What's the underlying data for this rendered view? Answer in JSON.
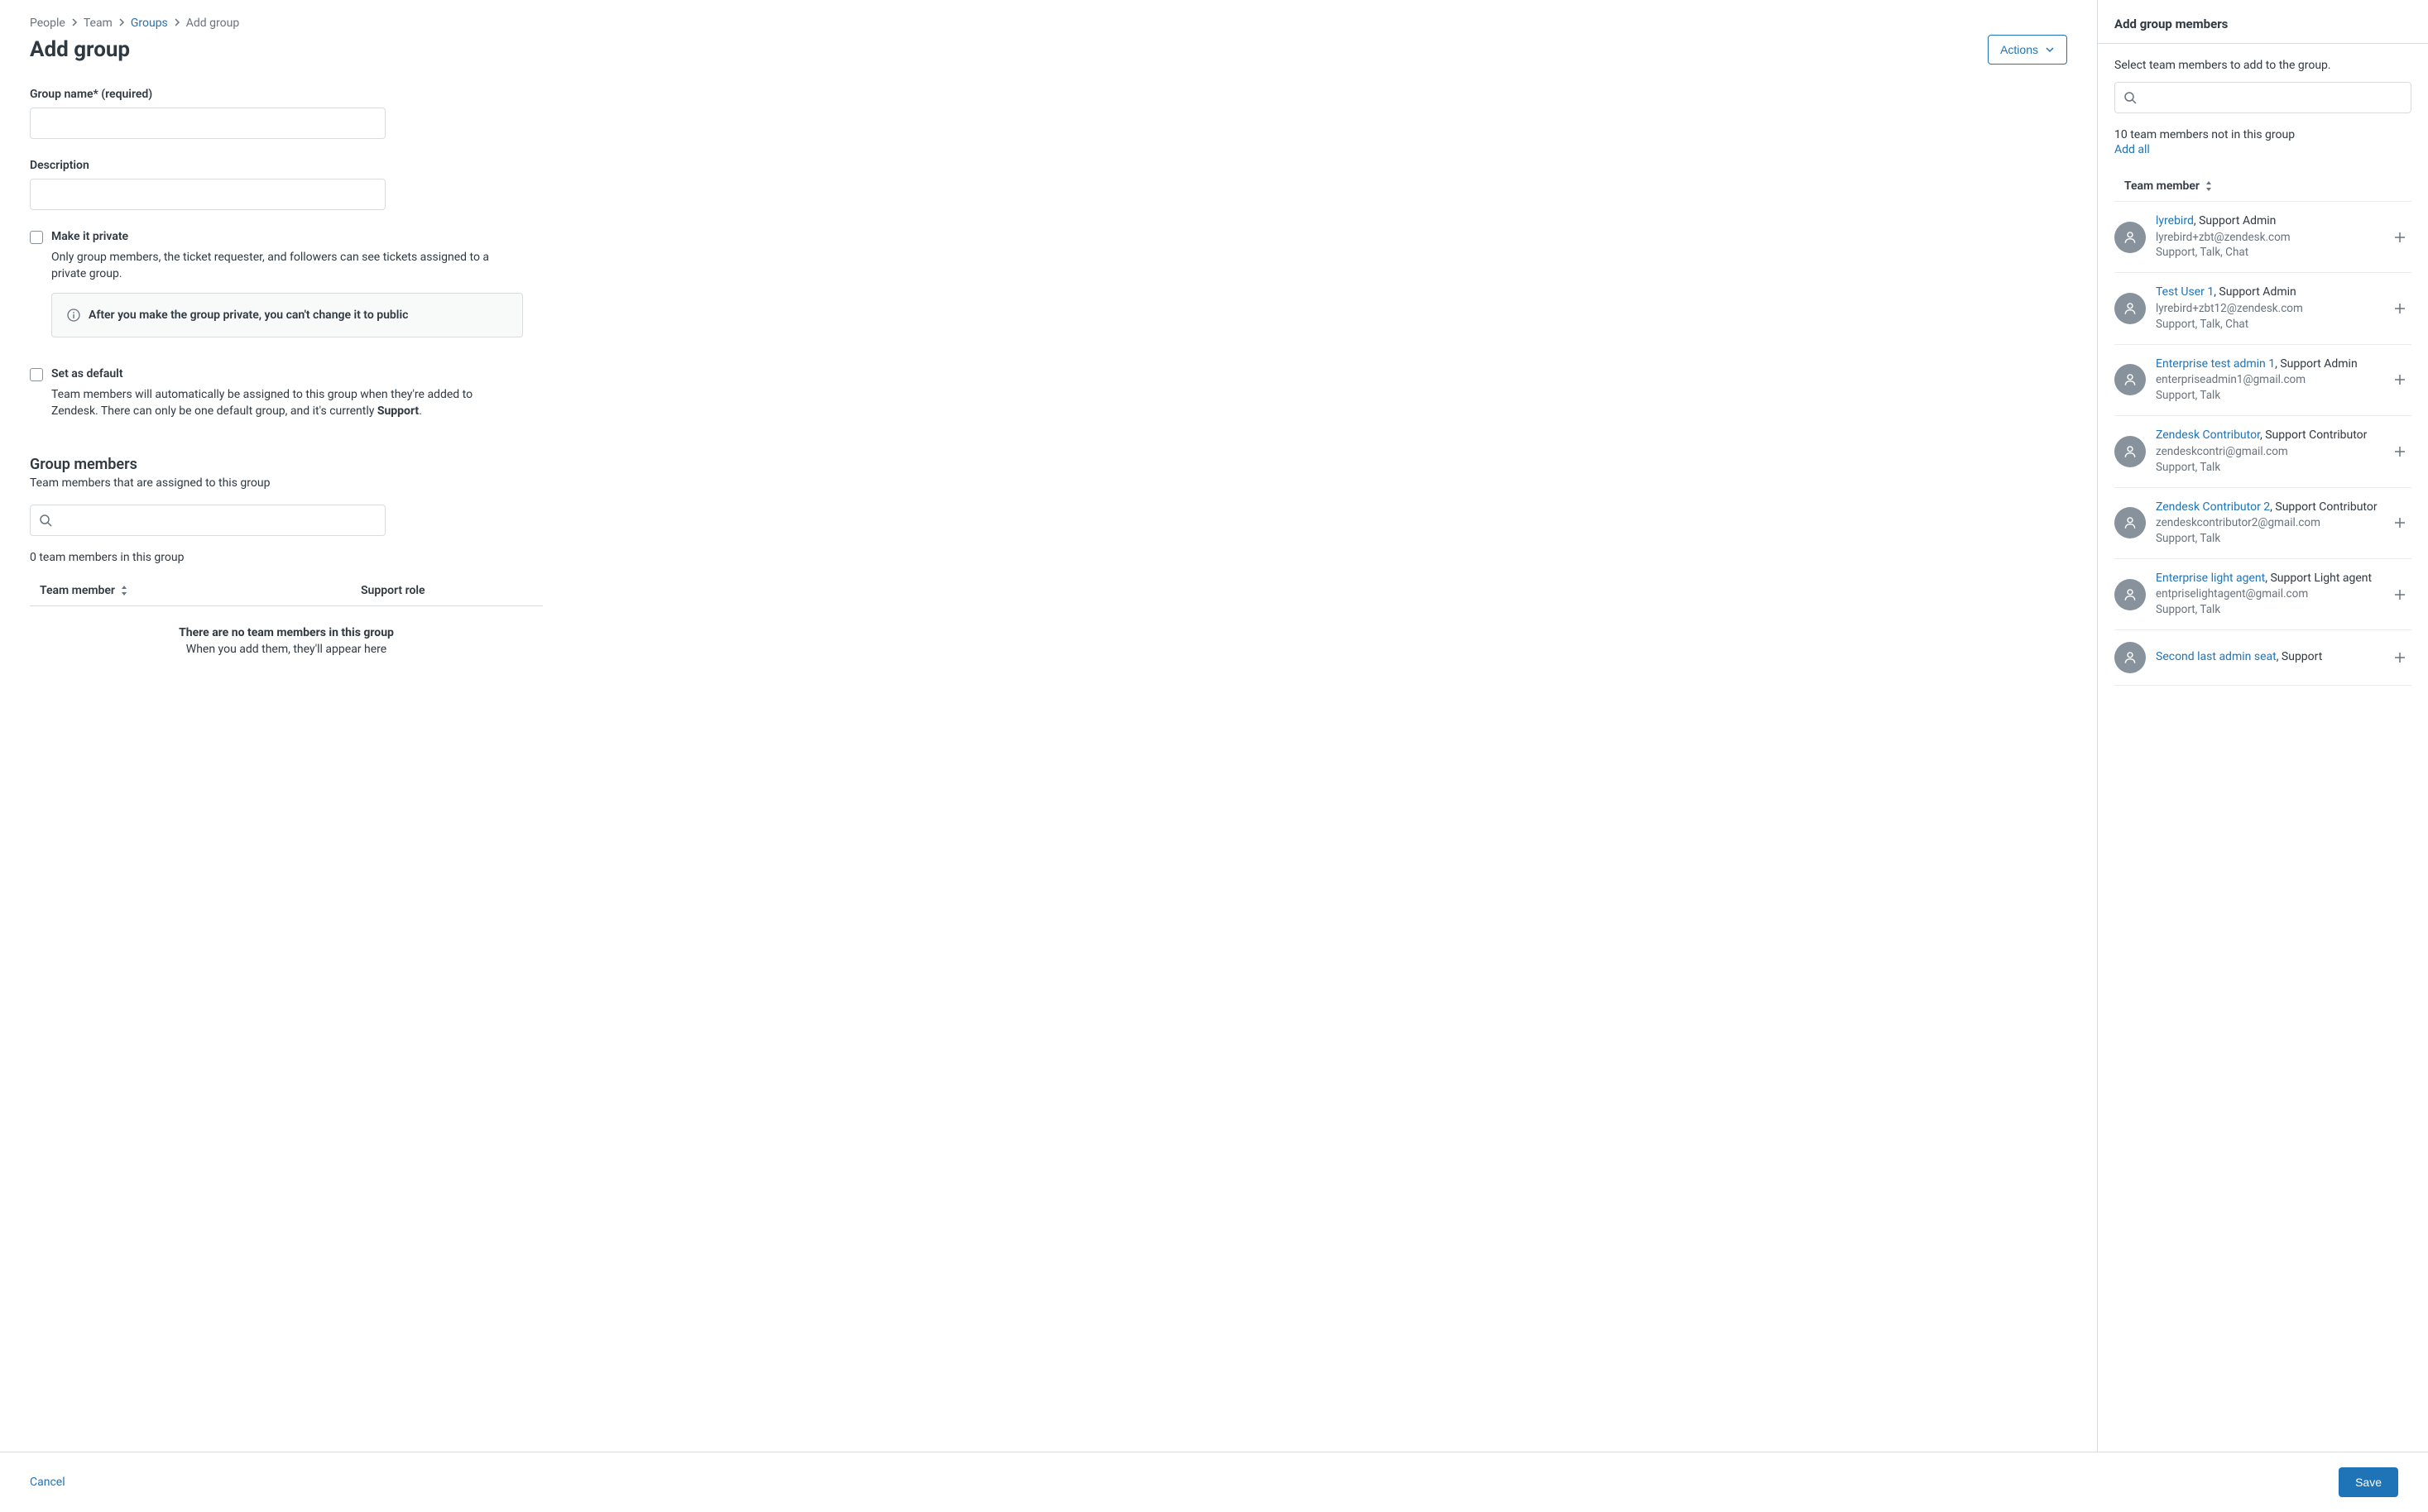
{
  "breadcrumbs": {
    "people": "People",
    "team": "Team",
    "groups": "Groups",
    "current": "Add group"
  },
  "page_title": "Add group",
  "actions_label": "Actions",
  "fields": {
    "group_name_label": "Group name* (required)",
    "group_name_value": "",
    "description_label": "Description",
    "description_value": "",
    "make_private_label": "Make it private",
    "make_private_desc": "Only group members, the ticket requester, and followers can see tickets assigned to a private group.",
    "private_warning": "After you make the group private, you can't change it to public",
    "set_default_label": "Set as default",
    "set_default_desc_1": "Team members will automatically be assigned to this group when they're added to Zendesk. There can only be one default group, and it's currently ",
    "set_default_desc_bold": "Support",
    "set_default_desc_2": "."
  },
  "group_members": {
    "title": "Group members",
    "subtitle": "Team members that are assigned to this group",
    "search_placeholder": "",
    "count_line": "0 team members in this group",
    "col_member": "Team member",
    "col_role": "Support role",
    "empty_title": "There are no team members in this group",
    "empty_sub": "When you add them, they'll appear here"
  },
  "sidebar": {
    "title": "Add group members",
    "hint": "Select team members to add to the group.",
    "search_placeholder": "",
    "count": "10 team members not in this group",
    "add_all": "Add all",
    "col_header": "Team member",
    "members": [
      {
        "name": "lyrebird",
        "role": ", Support Admin",
        "email": "lyrebird+zbt@zendesk.com",
        "products": "Support, Talk, Chat"
      },
      {
        "name": "Test User 1",
        "role": ", Support Admin",
        "email": "lyrebird+zbt12@zendesk.com",
        "products": "Support, Talk, Chat"
      },
      {
        "name": "Enterprise test admin 1",
        "role": ", Support Admin",
        "email": "enterpriseadmin1@gmail.com",
        "products": "Support, Talk"
      },
      {
        "name": "Zendesk Contributor",
        "role": ", Support Contributor",
        "email": "zendeskcontri@gmail.com",
        "products": "Support, Talk"
      },
      {
        "name": "Zendesk Contributor 2",
        "role": ", Support Contributor",
        "email": "zendeskcontributor2@gmail.com",
        "products": "Support, Talk"
      },
      {
        "name": "Enterprise light agent",
        "role": ", Support Light agent",
        "email": "entpriselightagent@gmail.com",
        "products": "Support, Talk"
      },
      {
        "name": "Second last admin seat",
        "role": ", Support",
        "email": "",
        "products": ""
      }
    ]
  },
  "footer": {
    "cancel": "Cancel",
    "save": "Save"
  }
}
